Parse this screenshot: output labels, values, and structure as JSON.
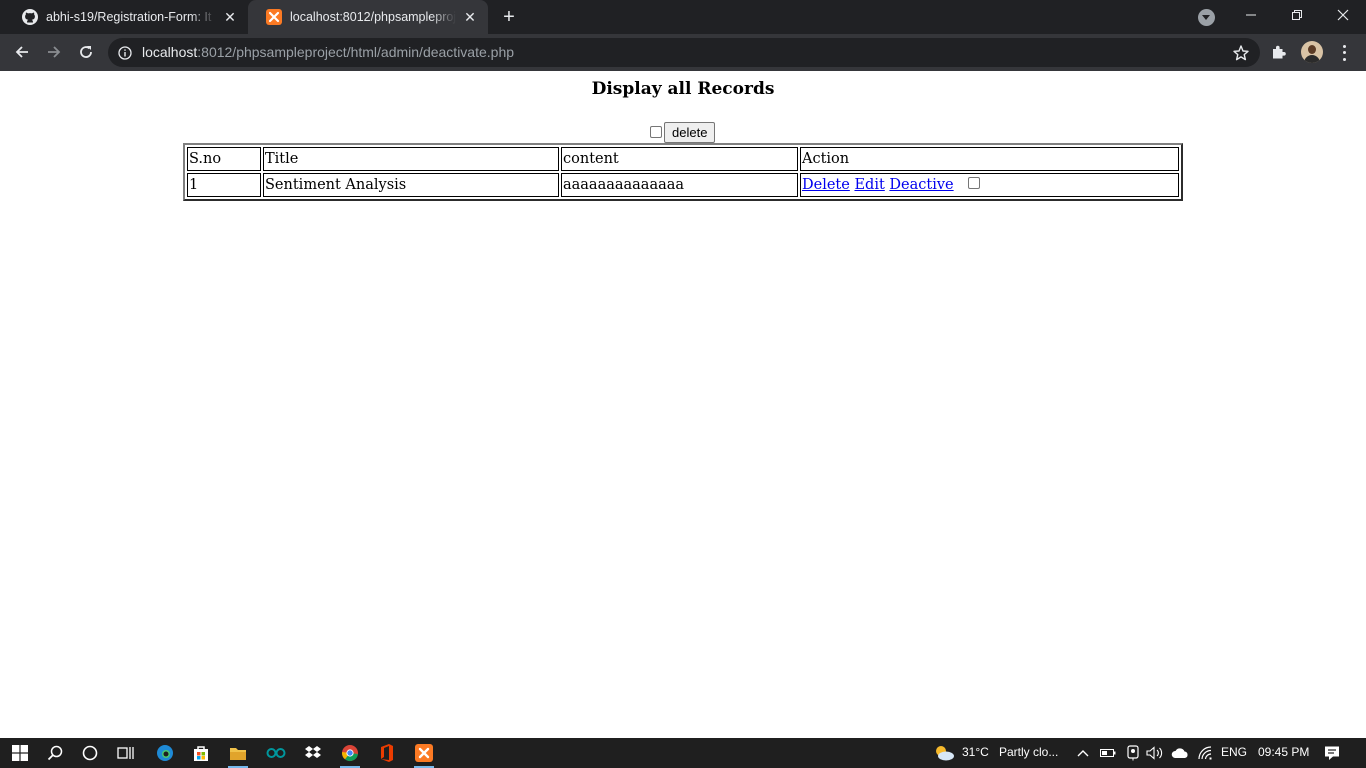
{
  "browser": {
    "tabs": [
      {
        "title": "abhi-s19/Registration-Form: It he",
        "active": false,
        "icon": "github-icon"
      },
      {
        "title": "localhost:8012/phpsampleproject",
        "active": true,
        "icon": "xampp-icon"
      }
    ],
    "address": {
      "host": "localhost",
      "path": ":8012/phpsampleproject/html/admin/deactivate.php"
    }
  },
  "page": {
    "heading": "Display all Records",
    "bulk_delete_label": "delete",
    "table": {
      "headers": [
        "S.no",
        "Title",
        "content",
        "Action"
      ],
      "rows": [
        {
          "sno": "1",
          "title": "Sentiment Analysis",
          "content": "aaaaaaaaaaaaaa",
          "actions": [
            "Delete",
            "Edit",
            "Deactive"
          ]
        }
      ]
    }
  },
  "taskbar": {
    "weather_temp": "31°C",
    "weather_text": "Partly clo...",
    "language": "ENG",
    "time": "09:45 PM"
  }
}
